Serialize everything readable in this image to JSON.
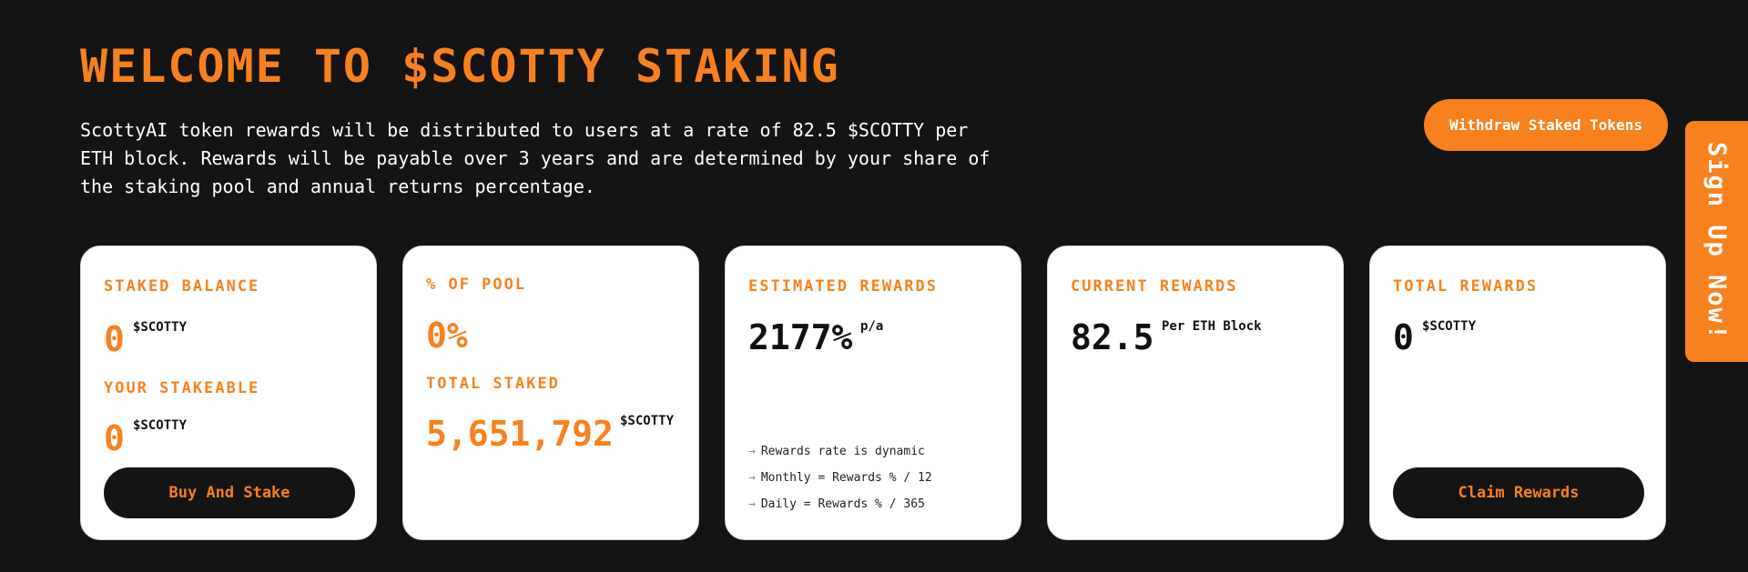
{
  "header": {
    "title": "WELCOME TO $SCOTTY STAKING",
    "description": "ScottyAI token rewards will be distributed to users at a rate of 82.5 $SCOTTY per ETH block. Rewards will be payable over 3 years and are determined by your share of the staking pool and annual returns percentage."
  },
  "withdraw_button": "Withdraw Staked Tokens",
  "signup_tab": "Sign Up Now!",
  "cards": {
    "staked": {
      "label": "STAKED BALANCE",
      "value": "0",
      "unit": "$SCOTTY",
      "stakeable_label": "YOUR STAKEABLE",
      "stakeable_value": "0",
      "stakeable_unit": "$SCOTTY",
      "button": "Buy And Stake"
    },
    "pool": {
      "label": "% OF POOL",
      "value": "0%",
      "total_label": "TOTAL STAKED",
      "total_value": "5,651,792",
      "total_unit": "$SCOTTY"
    },
    "estimated": {
      "label": "ESTIMATED REWARDS",
      "value": "2177%",
      "unit": "p/a",
      "notes": [
        "Rewards rate is dynamic",
        "Monthly = Rewards % / 12",
        "Daily = Rewards % / 365"
      ]
    },
    "current": {
      "label": "CURRENT REWARDS",
      "value": "82.5",
      "unit": "Per ETH Block"
    },
    "total": {
      "label": "TOTAL REWARDS",
      "value": "0",
      "unit": "$SCOTTY",
      "button": "Claim Rewards"
    }
  },
  "colors": {
    "accent": "#f7811f",
    "background": "#141414",
    "card": "#ffffff"
  },
  "icons": {
    "note_bullet": "arrow-right-icon"
  }
}
